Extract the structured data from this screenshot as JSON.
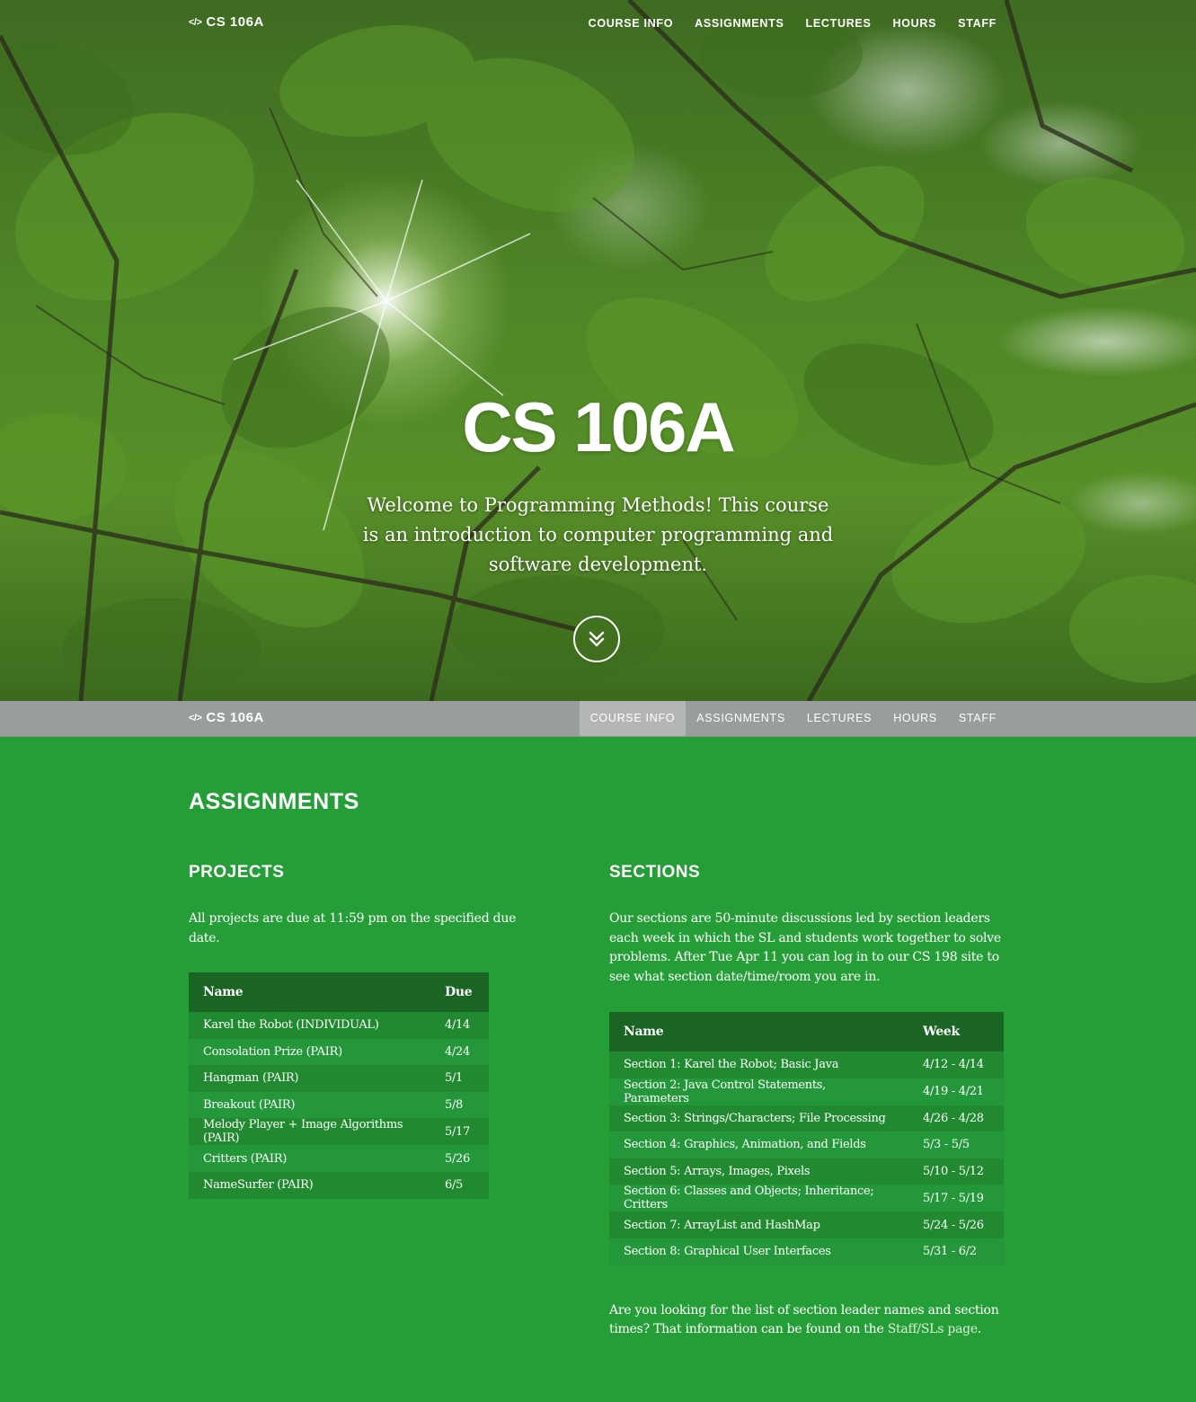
{
  "brand": {
    "icon": "code-icon",
    "icon_glyph": "</>",
    "name": "CS 106A"
  },
  "nav": {
    "items": [
      "COURSE INFO",
      "ASSIGNMENTS",
      "LECTURES",
      "HOURS",
      "STAFF"
    ],
    "active": "COURSE INFO"
  },
  "hero": {
    "title": "CS 106A",
    "subtitle": "Welcome to Programming Methods! This course is an introduction to computer programming and software development.",
    "scroll_icon": "double-chevron-down-icon"
  },
  "content": {
    "section_title": "ASSIGNMENTS",
    "projects": {
      "heading": "PROJECTS",
      "note": "All projects are due at 11:59 pm on the specified due date.",
      "columns": [
        "Name",
        "Due"
      ],
      "rows": [
        [
          "Karel the Robot (INDIVIDUAL)",
          "4/14"
        ],
        [
          "Consolation Prize (PAIR)",
          "4/24"
        ],
        [
          "Hangman (PAIR)",
          "5/1"
        ],
        [
          "Breakout (PAIR)",
          "5/8"
        ],
        [
          "Melody Player + Image Algorithms (PAIR)",
          "5/17"
        ],
        [
          "Critters (PAIR)",
          "5/26"
        ],
        [
          "NameSurfer (PAIR)",
          "6/5"
        ]
      ]
    },
    "sections": {
      "heading": "SECTIONS",
      "intro": "Our sections are 50-minute discussions led by section leaders each week in which the SL and students work together to solve problems. After Tue Apr 11 you can log in to our CS 198 site to see what section date/time/room you are in.",
      "columns": [
        "Name",
        "Week"
      ],
      "rows": [
        [
          "Section 1: Karel the Robot; Basic Java",
          "4/12 - 4/14"
        ],
        [
          "Section 2: Java Control Statements, Parameters",
          "4/19 - 4/21"
        ],
        [
          "Section 3: Strings/Characters; File Processing",
          "4/26 - 4/28"
        ],
        [
          "Section 4: Graphics, Animation, and Fields",
          "5/3 - 5/5"
        ],
        [
          "Section 5: Arrays, Images, Pixels",
          "5/10 - 5/12"
        ],
        [
          "Section 6: Classes and Objects; Inheritance; Critters",
          "5/17 - 5/19"
        ],
        [
          "Section 7: ArrayList and HashMap",
          "5/24 - 5/26"
        ],
        [
          "Section 8: Graphical User Interfaces",
          "5/31 - 6/2"
        ]
      ],
      "outro_text": "Are you looking for the list of section leader names and section times? That information can be found on the ",
      "outro_link": "Staff/SLs page",
      "outro_end": "."
    }
  },
  "colors": {
    "content_bg": "#259e38",
    "table_header": "#1a6524",
    "row_dark": "#218a30",
    "row_light": "#24973a",
    "subnav_bg": "#999d9d"
  }
}
